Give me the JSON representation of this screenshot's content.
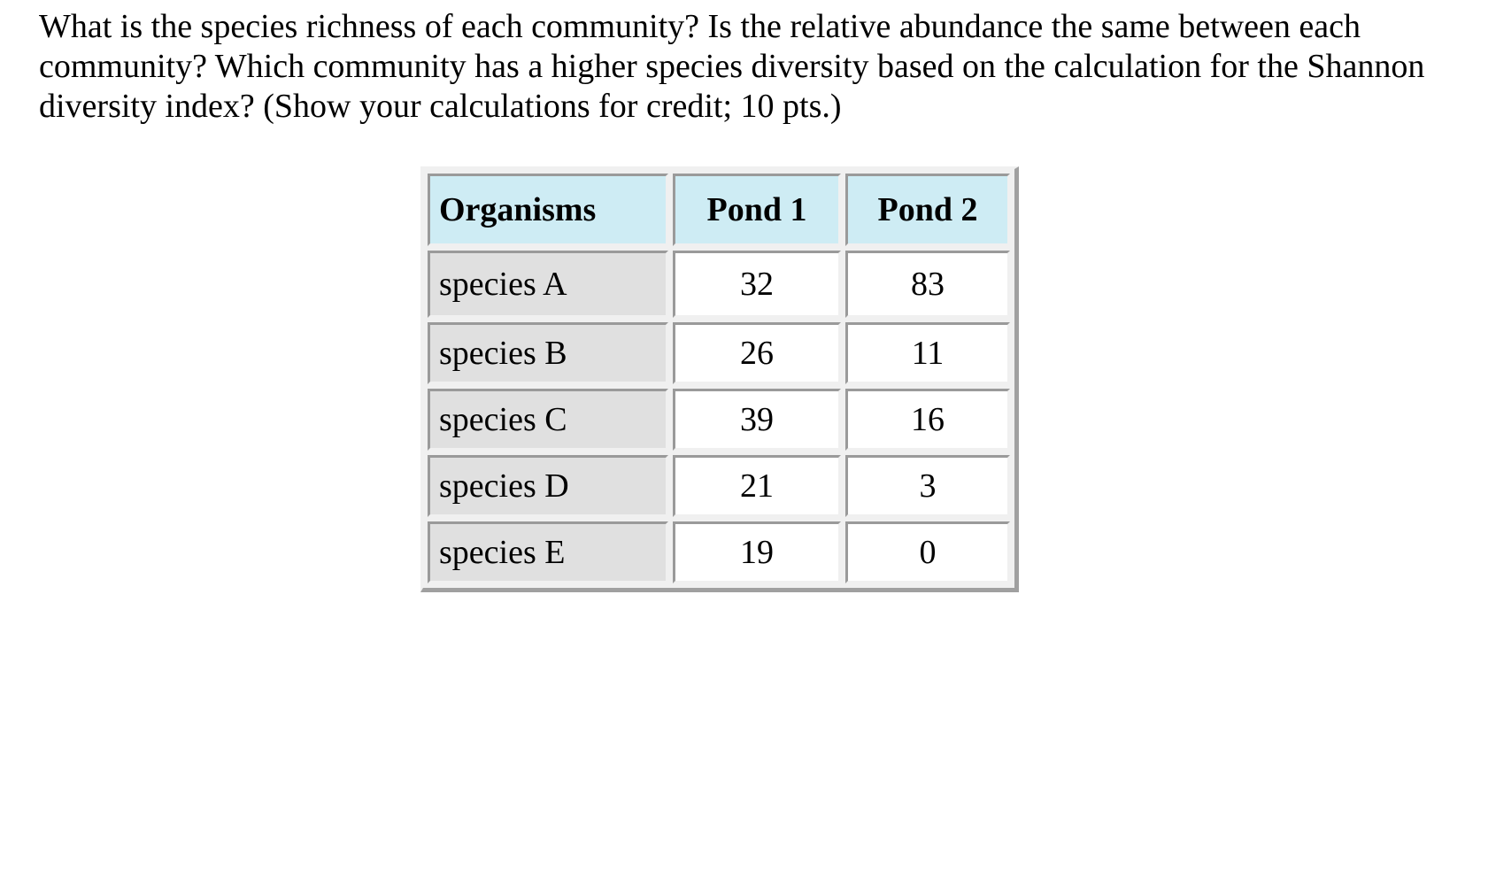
{
  "question": {
    "text": "What is the species richness of each community?  Is the relative abundance the same between each community?  Which community has a higher species diversity based on the calculation for the Shannon diversity index? (Show your calculations for credit; 10 pts.)"
  },
  "table": {
    "headers": [
      "Organisms",
      "Pond 1",
      "Pond 2"
    ],
    "rows": [
      {
        "organism": "species A",
        "pond1": "32",
        "pond2": "83"
      },
      {
        "organism": "species B",
        "pond1": "26",
        "pond2": "11"
      },
      {
        "organism": "species C",
        "pond1": "39",
        "pond2": "16"
      },
      {
        "organism": "species D",
        "pond1": "21",
        "pond2": "3"
      },
      {
        "organism": "species E",
        "pond1": "19",
        "pond2": "0"
      }
    ]
  },
  "colors": {
    "header_bg": "#ceecf4",
    "name_cell_bg": "#e0e0e0",
    "value_cell_bg": "#ffffff",
    "border": "#9a9a9a"
  }
}
